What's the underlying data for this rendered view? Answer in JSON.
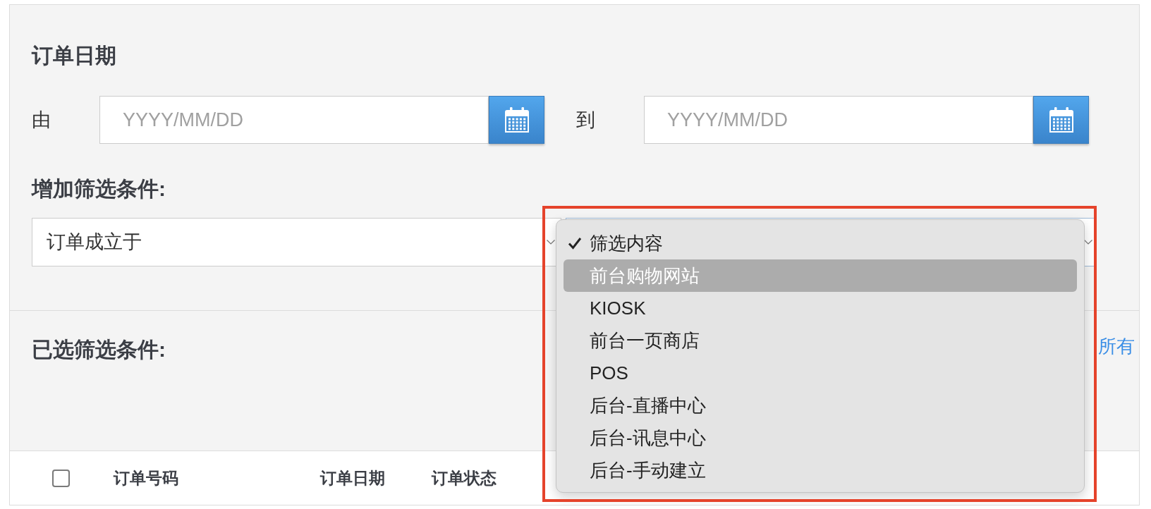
{
  "order_date": {
    "heading": "订单日期",
    "from": {
      "label": "由",
      "placeholder": "YYYY/MM/DD"
    },
    "to": {
      "label": "到",
      "placeholder": "YYYY/MM/DD"
    }
  },
  "add_filter": {
    "heading": "增加筛选条件:",
    "field_select": {
      "value": "订单成立于"
    },
    "value_select": {
      "expanded": true,
      "options": [
        {
          "label": "筛选内容",
          "selected": true,
          "highlighted": false
        },
        {
          "label": "前台购物网站",
          "selected": false,
          "highlighted": true
        },
        {
          "label": "KIOSK",
          "selected": false,
          "highlighted": false
        },
        {
          "label": "前台一页商店",
          "selected": false,
          "highlighted": false
        },
        {
          "label": "POS",
          "selected": false,
          "highlighted": false
        },
        {
          "label": "后台-直播中心",
          "selected": false,
          "highlighted": false
        },
        {
          "label": "后台-讯息中心",
          "selected": false,
          "highlighted": false
        },
        {
          "label": "后台-手动建立",
          "selected": false,
          "highlighted": false
        }
      ]
    }
  },
  "selected_filters": {
    "heading": "已选筛选条件:",
    "link": "所有"
  },
  "table": {
    "select_all": {
      "checked": false
    },
    "columns": [
      "订单号码",
      "订单日期",
      "订单状态"
    ]
  }
}
